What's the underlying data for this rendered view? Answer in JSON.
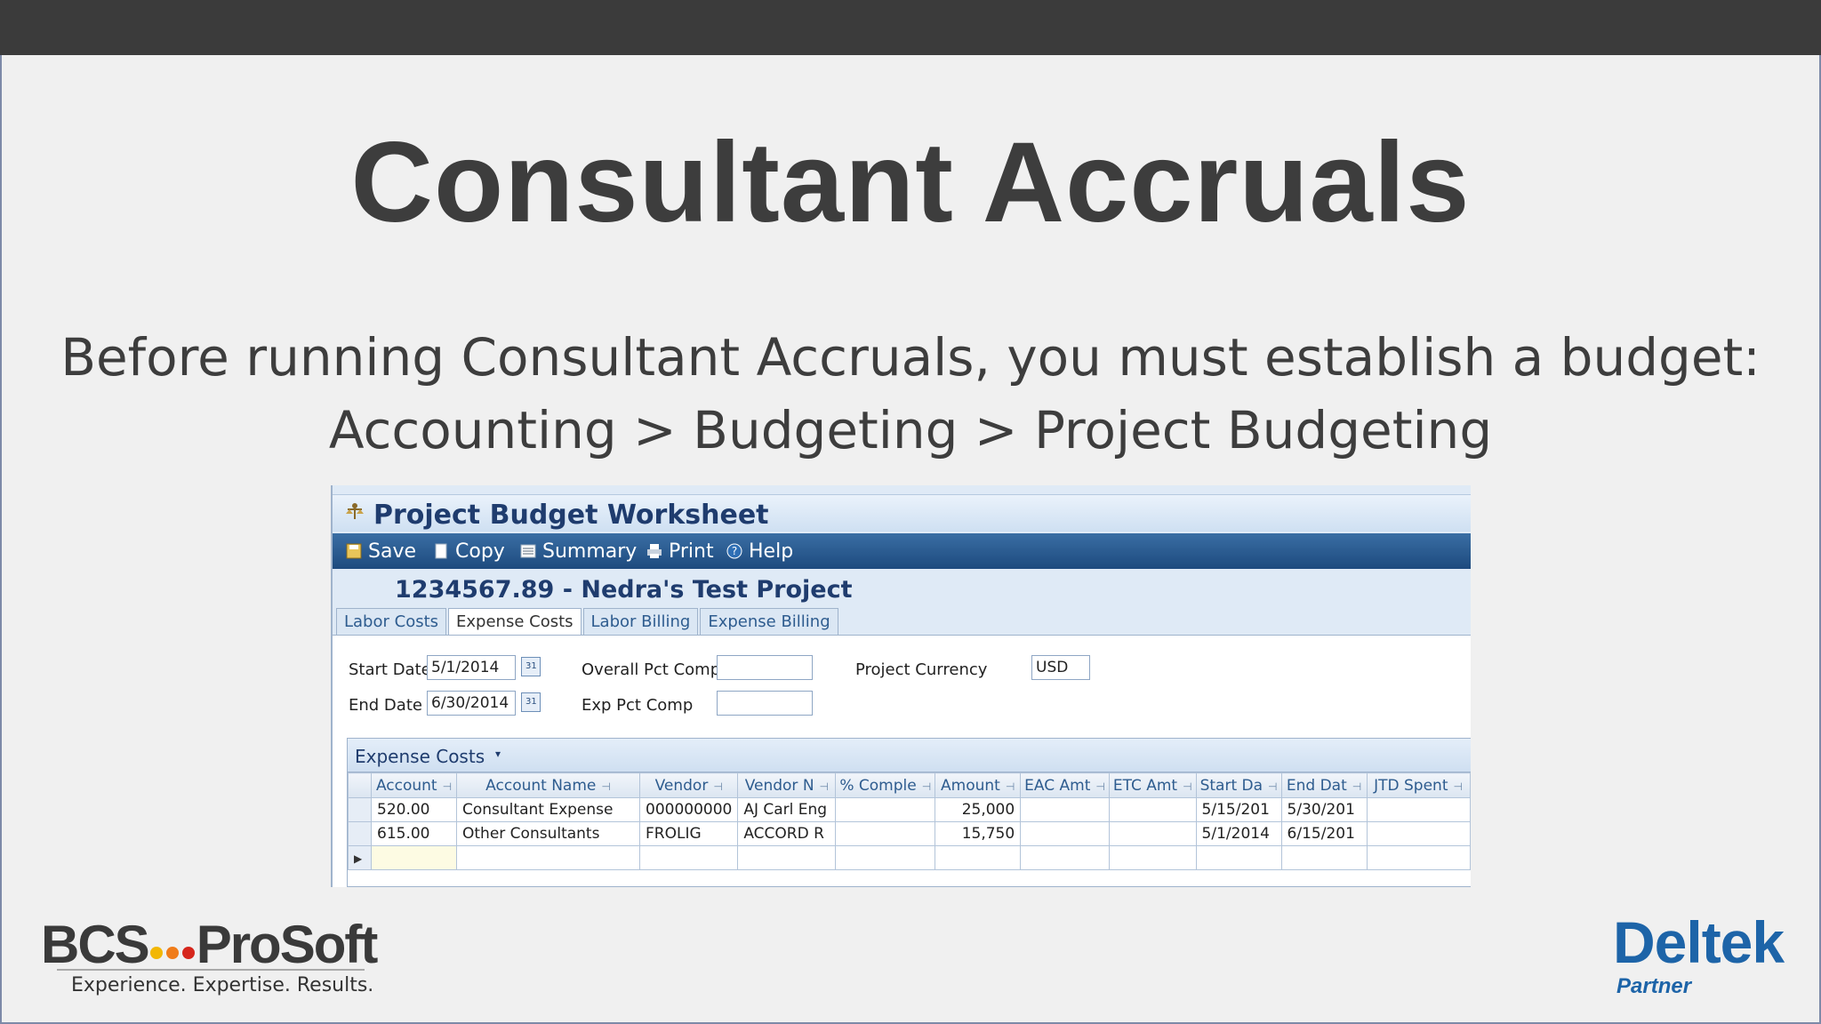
{
  "slide": {
    "title": "Consultant Accruals",
    "subtitle_line1": "Before running Consultant Accruals, you must establish a budget:",
    "subtitle_line2": "Accounting > Budgeting > Project Budgeting"
  },
  "worksheet": {
    "title": "Project Budget Worksheet",
    "toolbar": {
      "save": "Save",
      "copy": "Copy",
      "summary": "Summary",
      "print": "Print",
      "help": "Help"
    },
    "project": "1234567.89 - Nedra's Test Project",
    "tabs": [
      "Labor Costs",
      "Expense Costs",
      "Labor Billing",
      "Expense Billing"
    ],
    "active_tab": "Expense Costs",
    "form": {
      "start_date_label": "Start Date",
      "start_date_value": "5/1/2014",
      "end_date_label": "End Date",
      "end_date_value": "6/30/2014",
      "overall_pct_label": "Overall Pct Comp",
      "overall_pct_value": "",
      "exp_pct_label": "Exp Pct Comp",
      "exp_pct_value": "",
      "currency_label": "Project Currency",
      "currency_value": "USD"
    },
    "grid": {
      "title": "Expense Costs",
      "columns": [
        "Account",
        "Account Name",
        "Vendor",
        "Vendor N",
        "% Comple",
        "Amount",
        "EAC Amt",
        "ETC Amt",
        "Start Da",
        "End Dat",
        "JTD Spent"
      ],
      "rows": [
        [
          "520.00",
          "Consultant Expense",
          "000000000",
          "AJ Carl Eng",
          "",
          "25,000",
          "",
          "",
          "5/15/201",
          "5/30/201",
          ""
        ],
        [
          "615.00",
          "Other Consultants",
          "FROLIG",
          "ACCORD R",
          "",
          "15,750",
          "",
          "",
          "5/1/2014",
          "6/15/201",
          ""
        ]
      ]
    }
  },
  "logos": {
    "bcs_left": "BCS",
    "bcs_right": "ProSoft",
    "bcs_tagline": "Experience. Expertise. Results.",
    "deltek": "Deltek",
    "deltek_sub": "Partner"
  },
  "colors": {
    "topbar": "#3b3b3b",
    "title_text": "#3d3d3d",
    "toolbar": "#1d4a7e",
    "deltek_blue": "#1d64a8",
    "dot_yellow": "#f2b705",
    "dot_orange": "#f07c1a",
    "dot_red": "#d6261c"
  }
}
